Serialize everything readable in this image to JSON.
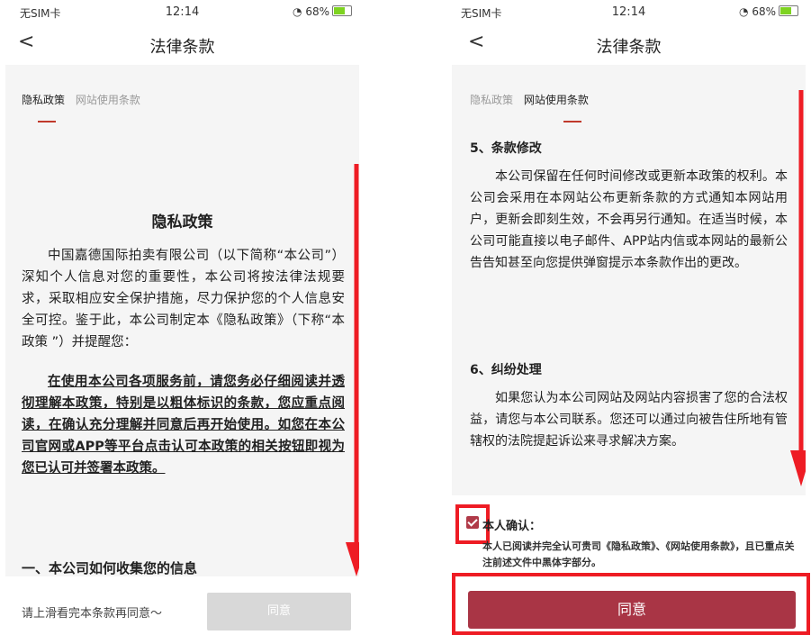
{
  "left": {
    "status": {
      "carrier": "无SIM卡",
      "time": "12:14",
      "battery": "68%"
    },
    "nav": {
      "back_label": "<",
      "title": "法律条款"
    },
    "tabs": [
      {
        "label": "隐私政策"
      },
      {
        "label": "网站使用条款"
      }
    ],
    "doc_title": "隐私政策",
    "intro": "中国嘉德国际拍卖有限公司（以下简称“本公司”）深知个人信息对您的重要性，本公司将按法律法规要求，采取相应安全保护措施，尽力保护您的个人信息安全可控。鉴于此，本公司制定本《隐私政策》（下称“本政策 ”）并提醒您：",
    "bold_notice": "在使用本公司各项服务前，请您务必仔细阅读并透彻理解本政策，特别是以粗体标识的条款，您应重点阅读，在确认充分理解并同意后再开始使用。如您在本公司官网或APP等平台点击认可本政策的相关按钮即视为您已认可并签署本政策。",
    "section1": "一、本公司如何收集您的信息",
    "footer_hint": "请上滑看完本条款再同意～",
    "agree_button": "同意"
  },
  "right": {
    "status": {
      "carrier": "无SIM卡",
      "time": "12:14",
      "battery": "68%"
    },
    "nav": {
      "back_label": "<",
      "title": "法律条款"
    },
    "tabs": [
      {
        "label": "隐私政策"
      },
      {
        "label": "网站使用条款"
      }
    ],
    "section5": "5、条款修改",
    "para5": "本公司保留在任何时间修改或更新本政策的权利。本公司会采用在本网站公布更新条款的方式通知本网站用户，更新会即刻生效，不会再另行通知。在适当时候，本公司可能直接以电子邮件、APP站内信或本网站的最新公告告知甚至向您提供弹窗提示本条款作出的更改。",
    "section6": "6、纠纷处理",
    "para6": "如果您认为本公司网站及网站内容损害了您的合法权益，请您与本公司联系。您还可以通过向被告住所地有管辖权的法院提起诉讼来寻求解决方案。",
    "confirm_label": "本人确认：",
    "confirm_text": "本人已阅读并完全认可贵司《隐私政策》、《网站使用条款》，且已重点关注前述文件中黑体字部分。",
    "agree_button": "同意"
  },
  "colors": {
    "accent": "#a93545",
    "annotation": "#ee1c24",
    "tab_underline": "#c0392b"
  }
}
